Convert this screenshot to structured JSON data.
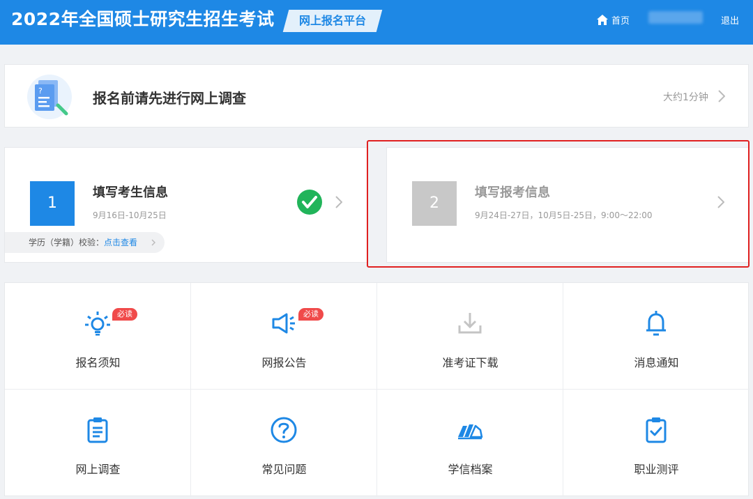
{
  "header": {
    "title": "2022年全国硕士研究生招生考试",
    "platform_label": "网上报名平台",
    "home_label": "首页",
    "logout_label": "退出"
  },
  "survey": {
    "title": "报名前请先进行网上调查",
    "duration": "大约1分钟"
  },
  "steps": [
    {
      "number": "1",
      "title": "填写考生信息",
      "date": "9月16日-10月25日",
      "status": "completed"
    },
    {
      "number": "2",
      "title": "填写报考信息",
      "date": "9月24日-27日，10月5日-25日，9:00～22:00",
      "status": "disabled"
    }
  ],
  "verify": {
    "label": "学历（学籍）校验：",
    "link": "点击查看"
  },
  "tiles": [
    {
      "label": "报名须知",
      "icon": "lightbulb-icon",
      "badge": "必读"
    },
    {
      "label": "网报公告",
      "icon": "megaphone-icon",
      "badge": "必读"
    },
    {
      "label": "准考证下载",
      "icon": "download-icon"
    },
    {
      "label": "消息通知",
      "icon": "bell-icon"
    },
    {
      "label": "网上调查",
      "icon": "clipboard-list-icon"
    },
    {
      "label": "常见问题",
      "icon": "question-circle-icon"
    },
    {
      "label": "学信档案",
      "icon": "archive-icon"
    },
    {
      "label": "职业测评",
      "icon": "clipboard-check-icon"
    }
  ],
  "colors": {
    "primary": "#1e88e5",
    "badge_red": "#f04a4a",
    "success_green": "#21b45a",
    "highlight_red": "#e02020"
  }
}
